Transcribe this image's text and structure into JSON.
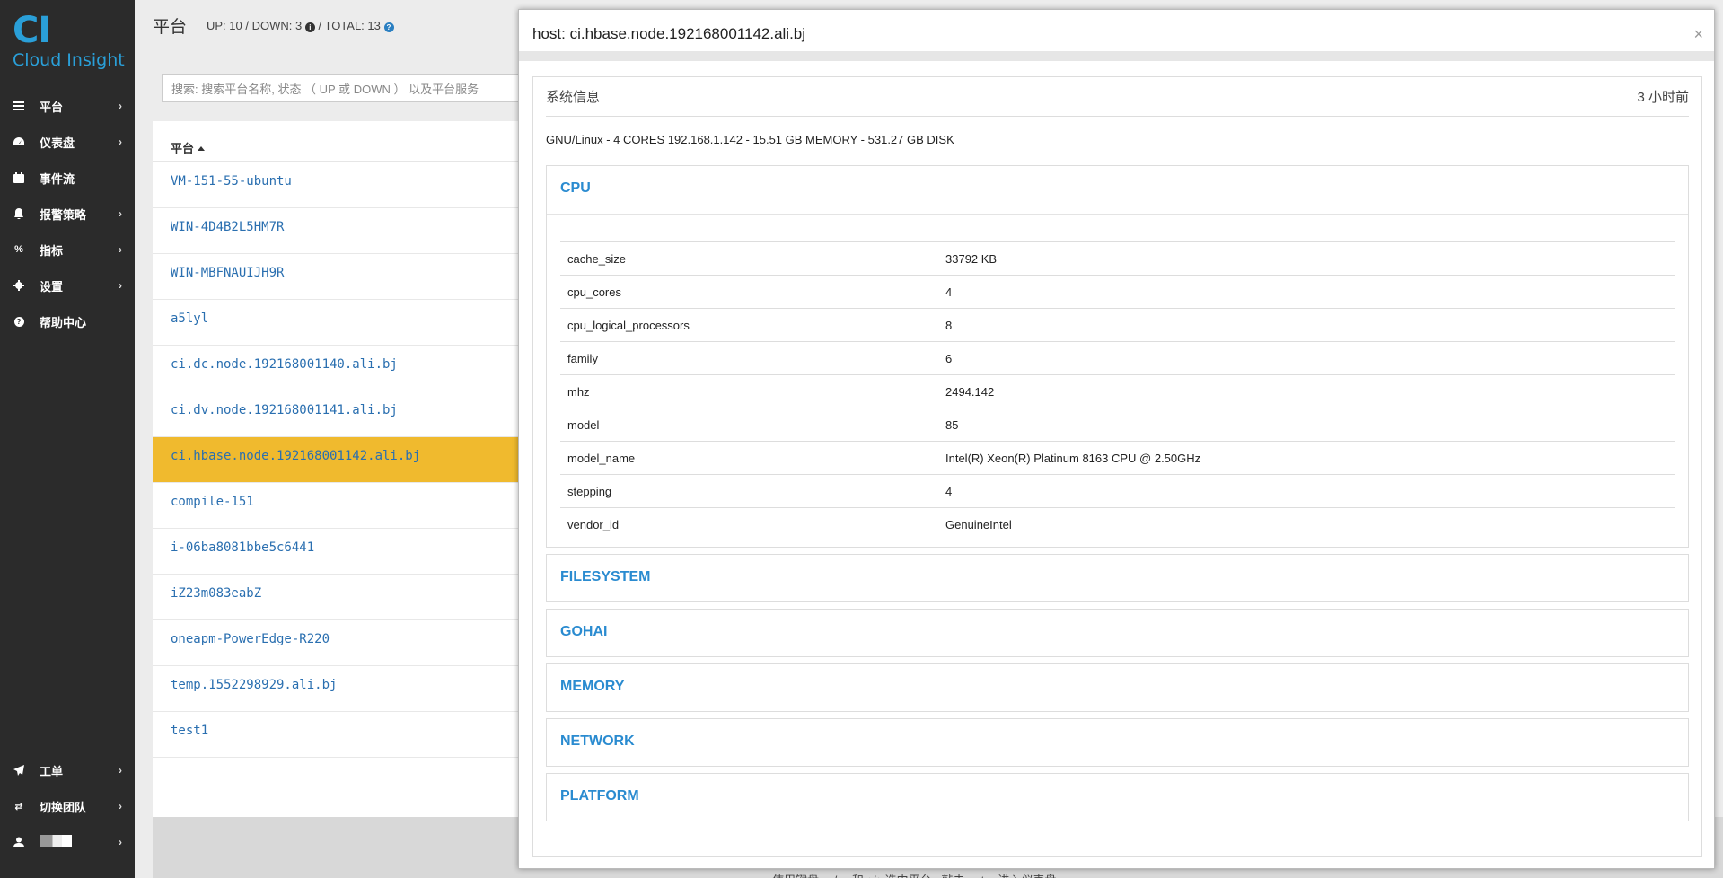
{
  "brand": {
    "mark": "CI",
    "name": "Cloud Insight",
    "color": "#2a9fd8"
  },
  "sidebar": {
    "items": [
      {
        "label": "平台",
        "icon": "list-icon"
      },
      {
        "label": "仪表盘",
        "icon": "dashboard-icon"
      },
      {
        "label": "事件流",
        "icon": "calendar-icon"
      },
      {
        "label": "报警策略",
        "icon": "bell-icon"
      },
      {
        "label": "指标",
        "icon": "percent-icon"
      },
      {
        "label": "设置",
        "icon": "gear-icon"
      },
      {
        "label": "帮助中心",
        "icon": "question-icon"
      }
    ],
    "bottom": [
      {
        "label": "工单",
        "icon": "send-icon"
      },
      {
        "label": "切换团队",
        "icon": "exchange-icon"
      }
    ]
  },
  "header": {
    "title": "平台",
    "up": "UP: 10",
    "down": "DOWN: 3",
    "total": "TOTAL: 13"
  },
  "search": {
    "placeholder": "搜索:  搜索平台名称,  状态 （ UP 或 DOWN ） 以及平台服务"
  },
  "list": {
    "column": "平台",
    "rows": [
      {
        "name": "VM-151-55-ubuntu",
        "os": "linux"
      },
      {
        "name": "WIN-4D4B2L5HM7R",
        "os": "windows"
      },
      {
        "name": "WIN-MBFNAUIJH9R",
        "os": "windows"
      },
      {
        "name": "a5lyl",
        "os": "linux"
      },
      {
        "name": "ci.dc.node.192168001140.ali.bj",
        "os": "linux"
      },
      {
        "name": "ci.dv.node.192168001141.ali.bj",
        "os": "linux"
      },
      {
        "name": "ci.hbase.node.192168001142.ali.bj",
        "os": "linux",
        "selected": true
      },
      {
        "name": "compile-151",
        "os": "linux"
      },
      {
        "name": "i-06ba8081bbe5c6441",
        "os": "linux"
      },
      {
        "name": "iZ23m083eabZ",
        "os": "linux"
      },
      {
        "name": "oneapm-PowerEdge-R220",
        "os": "linux"
      },
      {
        "name": "temp.1552298929.ali.bj",
        "os": "linux"
      },
      {
        "name": "test1",
        "os": "linux"
      }
    ]
  },
  "footer": {
    "text": "使用键盘 ←/→ 和 ↑/↓ 选中平台 , 敲击 enter 进入仪表盘"
  },
  "modal": {
    "title": "host: ci.hbase.node.192168001142.ali.bj",
    "close": "×",
    "sys_title": "系统信息",
    "sys_time": "3 小时前",
    "summary": "GNU/Linux - 4 CORES 192.168.1.142 - 15.51 GB MEMORY - 531.27 GB DISK",
    "cpu": {
      "title": "CPU",
      "rows": [
        {
          "key": "cache_size",
          "value": "33792 KB"
        },
        {
          "key": "cpu_cores",
          "value": "4"
        },
        {
          "key": "cpu_logical_processors",
          "value": "8"
        },
        {
          "key": "family",
          "value": "6"
        },
        {
          "key": "mhz",
          "value": "2494.142"
        },
        {
          "key": "model",
          "value": "85"
        },
        {
          "key": "model_name",
          "value": "Intel(R) Xeon(R) Platinum 8163 CPU @ 2.50GHz"
        },
        {
          "key": "stepping",
          "value": "4"
        },
        {
          "key": "vendor_id",
          "value": "GenuineIntel"
        }
      ]
    },
    "sections": [
      "FILESYSTEM",
      "GOHAI",
      "MEMORY",
      "NETWORK",
      "PLATFORM"
    ]
  },
  "colors": {
    "accent": "#2a8bd0",
    "selected_row": "#f0ba2e",
    "sidebar_bg": "#2b2b2b"
  }
}
